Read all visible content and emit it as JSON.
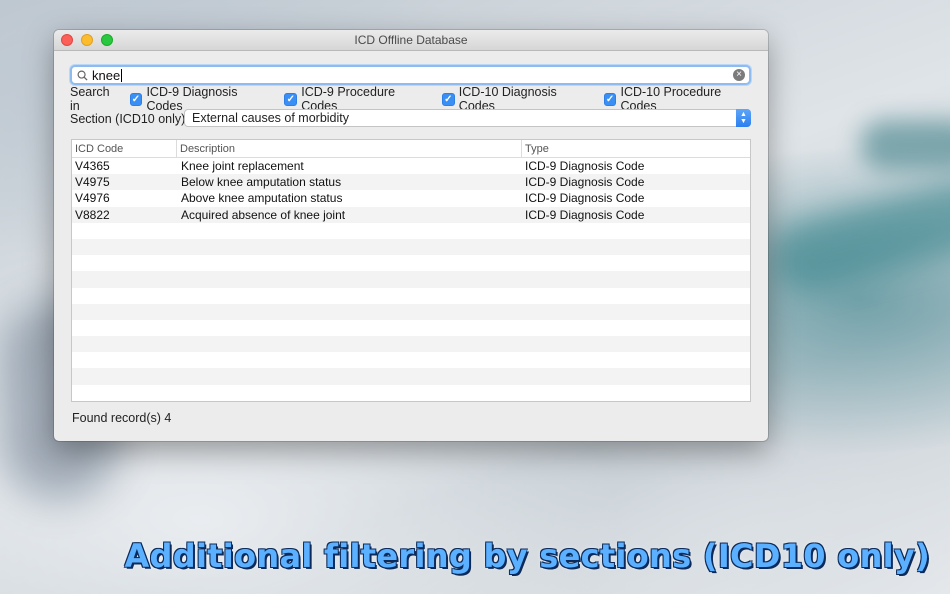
{
  "window": {
    "title": "ICD Offline Database"
  },
  "search": {
    "value": "knee"
  },
  "search_in": {
    "label": "Search in",
    "options": [
      {
        "label": "ICD-9 Diagnosis Codes",
        "checked": true
      },
      {
        "label": "ICD-9 Procedure Codes",
        "checked": true
      },
      {
        "label": "ICD-10 Diagnosis Codes",
        "checked": true
      },
      {
        "label": "ICD-10 Procedure Codes",
        "checked": true
      }
    ]
  },
  "section": {
    "label": "Section (ICD10 only)",
    "selected": "External causes of morbidity"
  },
  "table": {
    "columns": [
      "ICD Code",
      "Description",
      "Type"
    ],
    "rows": [
      {
        "code": "V4365",
        "description": "Knee joint replacement",
        "type": "ICD-9 Diagnosis Code"
      },
      {
        "code": "V4975",
        "description": "Below knee amputation status",
        "type": "ICD-9 Diagnosis Code"
      },
      {
        "code": "V4976",
        "description": "Above knee amputation status",
        "type": "ICD-9 Diagnosis Code"
      },
      {
        "code": "V8822",
        "description": "Acquired absence of knee joint",
        "type": "ICD-9 Diagnosis Code"
      }
    ]
  },
  "status": {
    "text": "Found record(s) 4"
  },
  "caption": {
    "text": "Additional filtering by sections (ICD10 only)"
  },
  "colors": {
    "accent": "#3a8ff5",
    "caption": "#5bb0ff"
  }
}
